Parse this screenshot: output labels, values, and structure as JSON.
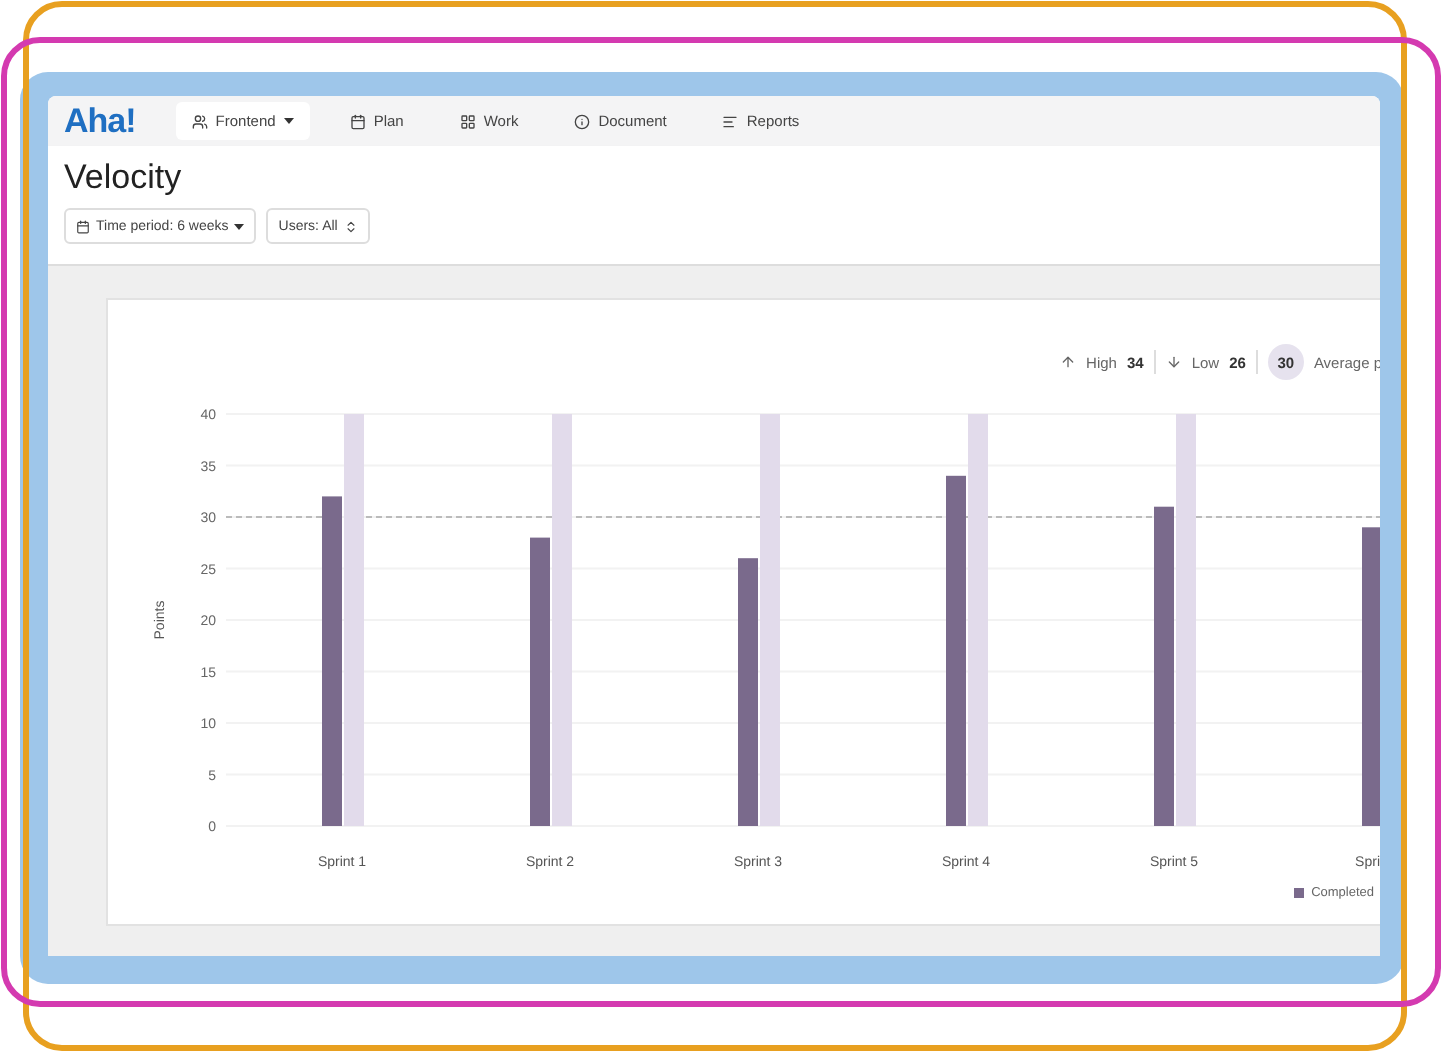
{
  "nav": {
    "logo": "Aha!",
    "workspace": {
      "label": "Frontend"
    },
    "items": [
      {
        "label": "Plan",
        "kind": "calendar"
      },
      {
        "label": "Work",
        "kind": "grid"
      },
      {
        "label": "Document",
        "kind": "info"
      },
      {
        "label": "Reports",
        "kind": "list"
      }
    ]
  },
  "page": {
    "title": "Velocity",
    "filters": [
      {
        "label": "Time period: 6 weeks",
        "kind": "period"
      },
      {
        "label": "Users: All",
        "kind": "users"
      }
    ]
  },
  "stats": [
    {
      "kind": "high",
      "label": "High",
      "value": "34"
    },
    {
      "kind": "low",
      "label": "Low",
      "value": "26"
    },
    {
      "kind": "average",
      "label": "Average p",
      "value": "30"
    }
  ],
  "chart_data": {
    "type": "bar",
    "ylabel": "Points",
    "categories": [
      "Sprint 1",
      "Sprint 2",
      "Sprint 3",
      "Sprint 4",
      "Sprint 5",
      "Spri"
    ],
    "series": [
      {
        "name": "Completed",
        "color": "#7a6a8c",
        "values": [
          32,
          28,
          26,
          34,
          31,
          29
        ]
      },
      {
        "color": "#e2dbeb",
        "values": [
          40,
          40,
          40,
          40,
          40,
          null
        ]
      }
    ],
    "ylim": [
      0,
      40
    ],
    "yticks": [
      0,
      5,
      10,
      15,
      20,
      25,
      30,
      35,
      40
    ],
    "grid": true,
    "ref_lines": [
      {
        "axis": "y",
        "value": 30
      }
    ]
  }
}
